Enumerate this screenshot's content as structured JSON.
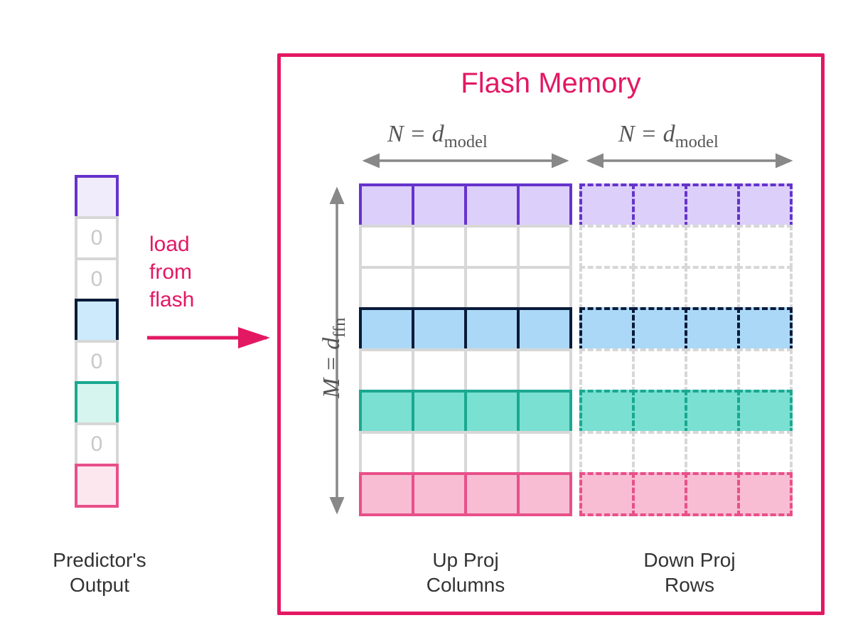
{
  "predictor": {
    "label": "Predictor's\nOutput",
    "cells": [
      {
        "fill": "#f1ecfb",
        "border": "#6633cc",
        "text": ""
      },
      {
        "fill": "#ffffff",
        "border": "#d7d7d7",
        "text": "0"
      },
      {
        "fill": "#ffffff",
        "border": "#d7d7d7",
        "text": "0"
      },
      {
        "fill": "#cceafc",
        "border": "#0a1b3a",
        "text": ""
      },
      {
        "fill": "#ffffff",
        "border": "#d7d7d7",
        "text": "0"
      },
      {
        "fill": "#d6f5ef",
        "border": "#1aa890",
        "text": ""
      },
      {
        "fill": "#ffffff",
        "border": "#d7d7d7",
        "text": "0"
      },
      {
        "fill": "#fde7ef",
        "border": "#e8508a",
        "text": ""
      }
    ]
  },
  "arrow": {
    "text": "load\nfrom\nflash",
    "color": "#e31863"
  },
  "flash": {
    "title": "Flash Memory",
    "n_label_left": "N = d",
    "n_sub": "model",
    "n_label_right": "N = d",
    "m_label": "M = d",
    "m_sub": "ffn",
    "up_label": "Up Proj\nColumns",
    "down_label": "Down Proj\nRows",
    "rows": [
      {
        "fill": "#dccffa",
        "border": "#6633cc"
      },
      {
        "fill": "#ffffff",
        "border": "#d7d7d7"
      },
      {
        "fill": "#ffffff",
        "border": "#d7d7d7"
      },
      {
        "fill": "#abd8f7",
        "border": "#0a1b3a"
      },
      {
        "fill": "#ffffff",
        "border": "#d7d7d7"
      },
      {
        "fill": "#79e0d2",
        "border": "#1aa890"
      },
      {
        "fill": "#ffffff",
        "border": "#d7d7d7"
      },
      {
        "fill": "#f8bdd2",
        "border": "#e8508a"
      }
    ],
    "cols": 4
  },
  "chart_data": {
    "type": "diagram",
    "description": "Sparse row/column loading from flash memory based on predictor output mask",
    "predictor_mask": [
      1,
      0,
      0,
      1,
      0,
      1,
      0,
      1
    ],
    "d_ffn_rows": 8,
    "d_model_cols": 4,
    "up_proj_matrix": "columns loaded where mask=1",
    "down_proj_matrix": "rows loaded where mask=1 (dashed = transposed view)"
  }
}
